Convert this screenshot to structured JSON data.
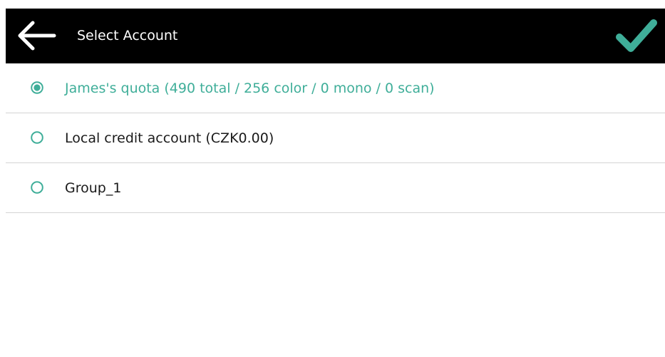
{
  "header": {
    "title": "Select Account",
    "back_icon": "arrow-left-icon",
    "confirm_icon": "checkmark-icon"
  },
  "colors": {
    "header_bg": "#000000",
    "accent": "#3fae99",
    "text": "#1a1a1a",
    "divider": "#d4d4d4"
  },
  "accounts": [
    {
      "label": "James's quota (490 total / 256 color / 0 mono / 0 scan)",
      "selected": true
    },
    {
      "label": "Local credit account (CZK0.00)",
      "selected": false
    },
    {
      "label": "Group_1",
      "selected": false
    }
  ]
}
